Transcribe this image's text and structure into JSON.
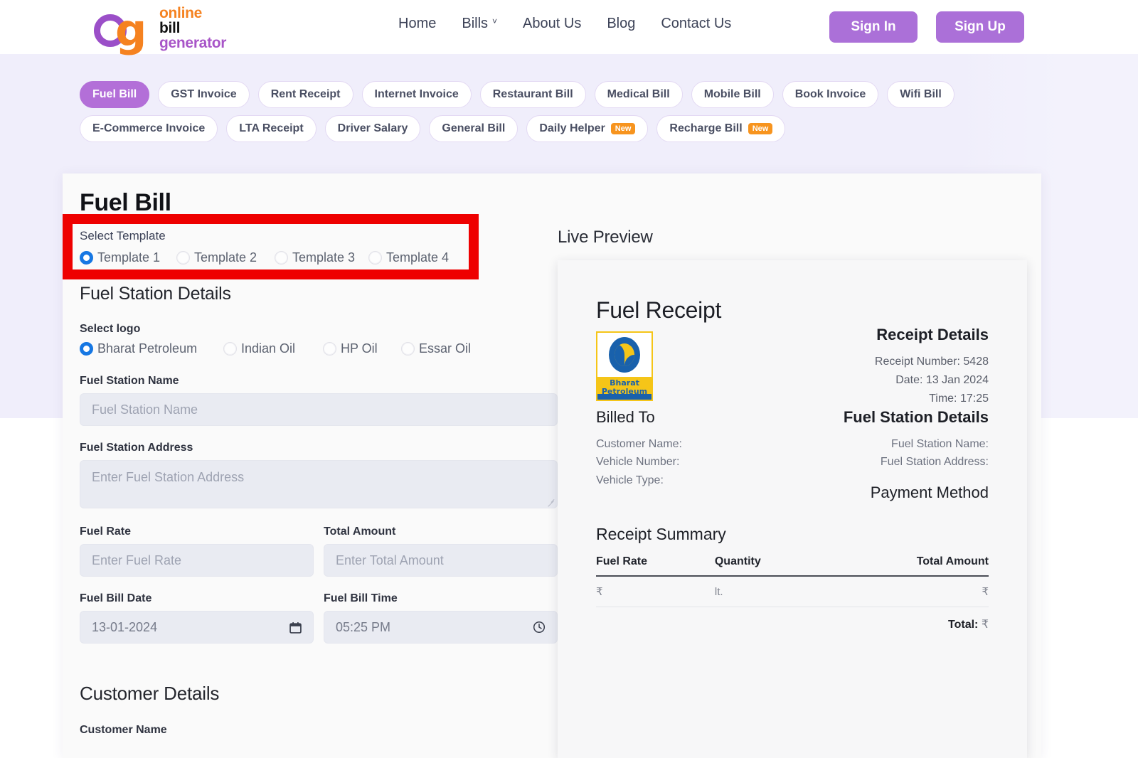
{
  "header": {
    "logo": {
      "o": "o",
      "g": "g",
      "line1": "online",
      "line2": "bill",
      "line3": "generator"
    },
    "nav": [
      {
        "label": "Home"
      },
      {
        "label": "Bills",
        "has_chevron": true
      },
      {
        "label": "About Us"
      },
      {
        "label": "Blog"
      },
      {
        "label": "Contact Us"
      }
    ],
    "sign_in": "Sign In",
    "sign_up": "Sign Up",
    "accent": "#ab70d8"
  },
  "chips": [
    {
      "label": "Fuel Bill",
      "active": true
    },
    {
      "label": "GST Invoice",
      "active": false
    },
    {
      "label": "Rent Receipt",
      "active": false
    },
    {
      "label": "Internet Invoice",
      "active": false
    },
    {
      "label": "Restaurant Bill",
      "active": false
    },
    {
      "label": "Medical Bill",
      "active": false
    },
    {
      "label": "Mobile Bill",
      "active": false
    },
    {
      "label": "Book Invoice",
      "active": false
    },
    {
      "label": "Wifi Bill",
      "active": false
    },
    {
      "label": "E-Commerce Invoice",
      "active": false
    },
    {
      "label": "LTA Receipt",
      "active": false
    },
    {
      "label": "Driver Salary",
      "active": false
    },
    {
      "label": "General Bill",
      "active": false
    },
    {
      "label": "Daily Helper",
      "active": false,
      "badge": "New"
    },
    {
      "label": "Recharge Bill",
      "active": false,
      "badge": "New"
    }
  ],
  "form": {
    "title": "Fuel Bill",
    "select_template_label": "Select Template",
    "templates": [
      {
        "label": "Template 1",
        "selected": true
      },
      {
        "label": "Template 2",
        "selected": false
      },
      {
        "label": "Template 3",
        "selected": false
      },
      {
        "label": "Template 4",
        "selected": false
      }
    ],
    "station_section": "Fuel Station Details",
    "select_logo_label": "Select logo",
    "logos": [
      {
        "label": "Bharat Petroleum",
        "selected": true
      },
      {
        "label": "Indian Oil",
        "selected": false
      },
      {
        "label": "HP Oil",
        "selected": false
      },
      {
        "label": "Essar Oil",
        "selected": false
      }
    ],
    "station_name_label": "Fuel Station Name",
    "station_name_placeholder": "Fuel Station Name",
    "station_name_value": "",
    "station_address_label": "Fuel Station Address",
    "station_address_placeholder": "Enter Fuel Station Address",
    "station_address_value": "",
    "fuel_rate_label": "Fuel Rate",
    "fuel_rate_placeholder": "Enter Fuel Rate",
    "fuel_rate_value": "",
    "total_amount_label": "Total Amount",
    "total_amount_placeholder": "Enter Total Amount",
    "total_amount_value": "",
    "bill_date_label": "Fuel Bill Date",
    "bill_date_value": "13-01-2024",
    "bill_time_label": "Fuel Bill Time",
    "bill_time_value": "05:25 PM",
    "customer_section": "Customer Details",
    "customer_name_label": "Customer Name"
  },
  "preview": {
    "title": "Live Preview",
    "receipt_title": "Fuel Receipt",
    "logo": {
      "name": "Bharat",
      "name2": "Petroleum"
    },
    "billed_to_head": "Billed To",
    "billed_to": [
      "Customer Name:",
      "Vehicle Number:",
      "Vehicle Type:"
    ],
    "receipt_details_head": "Receipt Details",
    "receipt_details": [
      {
        "key": "Receipt Number:",
        "value": "5428"
      },
      {
        "key": "Date:",
        "value": "13 Jan 2024"
      },
      {
        "key": "Time:",
        "value": "17:25"
      }
    ],
    "station_details_head": "Fuel Station Details",
    "station_details": [
      "Fuel Station Name:",
      "Fuel Station Address:"
    ],
    "payment_method_head": "Payment Method",
    "summary_head": "Receipt Summary",
    "summary_columns": [
      "Fuel Rate",
      "Quantity",
      "Total Amount"
    ],
    "summary_row": [
      "₹",
      "lt.",
      "₹"
    ],
    "total_label": "Total:",
    "total_value": "₹"
  },
  "annotation": {
    "color": "#ee0000"
  }
}
